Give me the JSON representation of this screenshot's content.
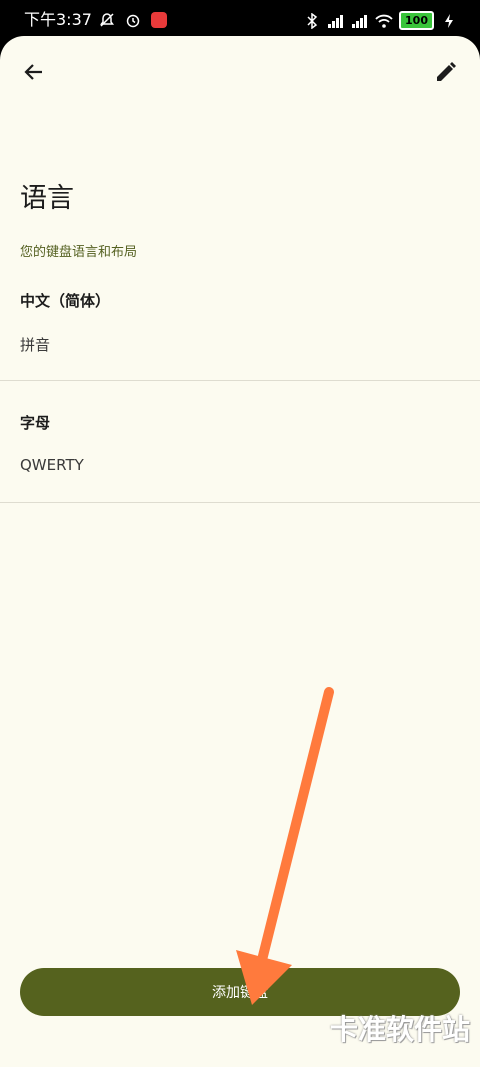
{
  "status_bar": {
    "time": "下午3:37",
    "battery": "100",
    "left_icons": [
      "notification-muted-icon",
      "alarm-icon",
      "app-badge-icon"
    ],
    "right_icons": [
      "bluetooth-icon",
      "signal-hd-1-icon",
      "signal-hd-2-icon",
      "wifi-icon",
      "battery-icon",
      "charging-icon"
    ]
  },
  "header": {
    "back_icon": "arrow-back-icon",
    "edit_icon": "pencil-icon"
  },
  "page": {
    "title": "语言",
    "subtitle": "您的键盘语言和布局"
  },
  "languages": [
    {
      "name": "中文（简体）",
      "layout": "拼音"
    },
    {
      "name": "字母",
      "layout": "QWERTY"
    }
  ],
  "add_button": {
    "label": "添加键盘"
  },
  "watermark": {
    "text": "卡准软件站"
  },
  "colors": {
    "background": "#fcfbf0",
    "accent": "#55621e",
    "subtitle": "#546020",
    "annotation_arrow": "#ff7a3d"
  }
}
